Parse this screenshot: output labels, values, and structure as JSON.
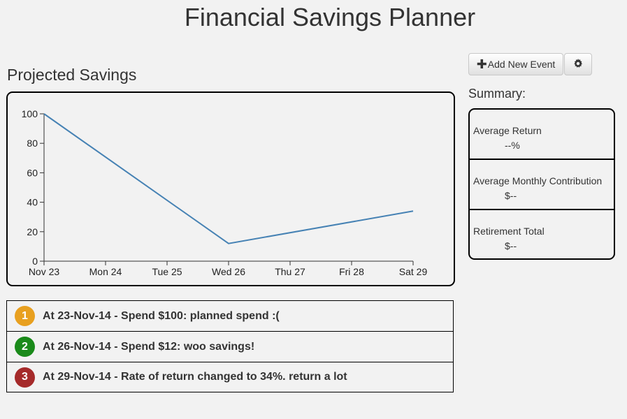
{
  "app": {
    "title": "Financial Savings Planner"
  },
  "main": {
    "section_title": "Projected Savings"
  },
  "toolbar": {
    "add_event_label": "Add New Event",
    "add_icon": "plus-icon",
    "settings_icon": "gear-icon"
  },
  "summary": {
    "title": "Summary:",
    "items": [
      {
        "label": "Average Return",
        "value": "--%"
      },
      {
        "label": "Average Monthly Contribution",
        "value": "$--"
      },
      {
        "label": "Retirement Total",
        "value": "$--"
      }
    ]
  },
  "events": [
    {
      "number": "1",
      "text": "At 23-Nov-14 - Spend $100: planned spend :(",
      "color": "#e8a020"
    },
    {
      "number": "2",
      "text": "At 26-Nov-14 - Spend $12: woo savings!",
      "color": "#1a8a1a"
    },
    {
      "number": "3",
      "text": "At 29-Nov-14 - Rate of return changed to 34%. return a lot",
      "color": "#a52a2a"
    }
  ],
  "chart_data": {
    "type": "line",
    "x": [
      "Nov 23",
      "Mon 24",
      "Tue 25",
      "Wed 26",
      "Thu 27",
      "Fri 28",
      "Sat 29"
    ],
    "series": [
      {
        "points": [
          {
            "x": "Nov 23",
            "y": 100
          },
          {
            "x": "Wed 26",
            "y": 12
          },
          {
            "x": "Sat 29",
            "y": 34
          }
        ]
      }
    ],
    "yticks": [
      0,
      20,
      40,
      60,
      80,
      100
    ],
    "ylim": [
      0,
      100
    ],
    "line_color": "#4682b4",
    "grid": false
  }
}
